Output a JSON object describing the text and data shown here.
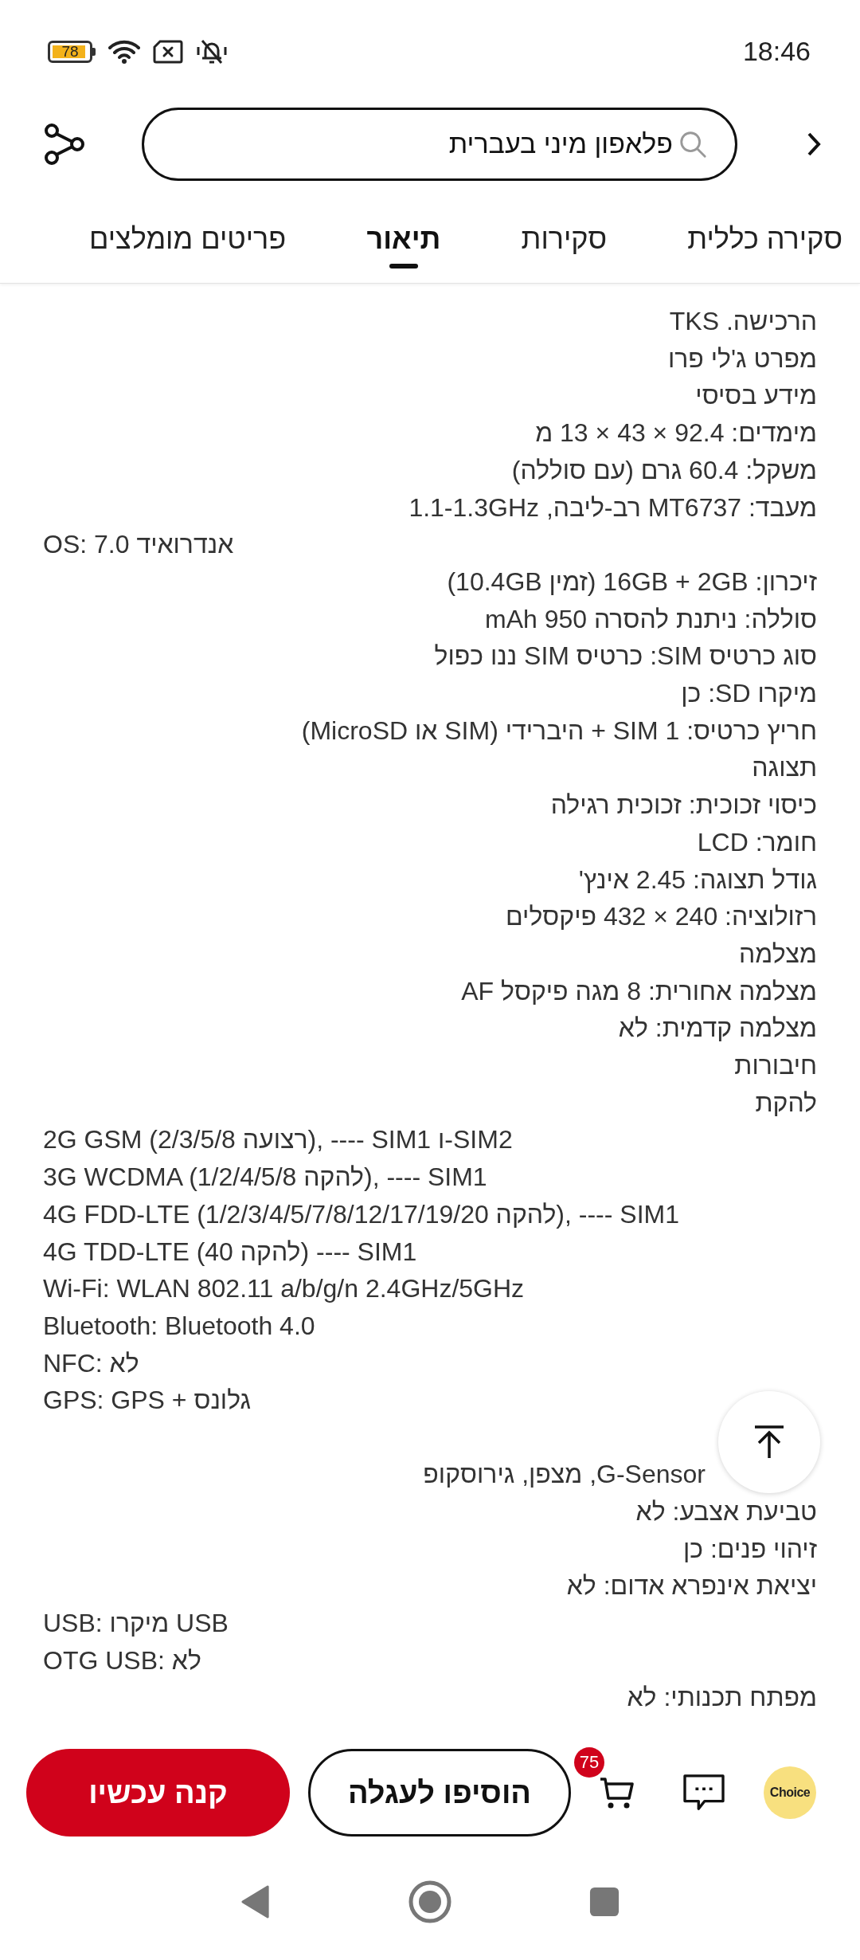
{
  "status_bar": {
    "battery": "78",
    "time": "18:46"
  },
  "search": {
    "value": "פלאפון מיני בעברית"
  },
  "tabs": [
    {
      "label": "סקירה כללית",
      "selected": false
    },
    {
      "label": "סקירות",
      "selected": false
    },
    {
      "label": "תיאור",
      "selected": true
    },
    {
      "label": "פריטים מומלצים",
      "selected": false
    }
  ],
  "description": [
    {
      "text": "הרכישה. TKS",
      "kind": "rtl"
    },
    {
      "text": "מפרט ג'לי פרו",
      "kind": "rtl"
    },
    {
      "text": "מידע בסיסי",
      "kind": "rtl"
    },
    {
      "text": "מימדים: 92.4 × 43 × 13 מ",
      "kind": "rtl"
    },
    {
      "text": "משקל: 60.4 גרם (עם סוללה)",
      "kind": "rtl"
    },
    {
      "text": "מעבד: MT6737 רב-ליבה, 1.1-1.3GHz",
      "kind": "rtl"
    },
    {
      "text": "OS: 7.0 אנדרואיד",
      "kind": "ltr"
    },
    {
      "text": "זיכרון: 16GB + 2GB (זמין 10.4GB)",
      "kind": "rtl"
    },
    {
      "text": "סוללה: ניתנת להסרה 950 mAh",
      "kind": "rtl"
    },
    {
      "text": "סוג כרטיס SIM: כרטיס SIM ננו כפול",
      "kind": "rtl"
    },
    {
      "text": "מיקרו SD: כן",
      "kind": "rtl"
    },
    {
      "text": "חריץ כרטיס: 1 SIM + היברידי (SIM או MicroSD)",
      "kind": "rtl"
    },
    {
      "text": "תצוגה",
      "kind": "rtl"
    },
    {
      "text": "כיסוי זכוכית: זכוכית רגילה",
      "kind": "rtl"
    },
    {
      "text": "חומר: LCD",
      "kind": "rtl"
    },
    {
      "text": "גודל תצוגה: 2.45 אינץ'",
      "kind": "rtl"
    },
    {
      "text": "רזולוציה: 240 × 432 פיקסלים",
      "kind": "rtl"
    },
    {
      "text": "מצלמה",
      "kind": "rtl"
    },
    {
      "text": "מצלמה אחורית: 8 מגה פיקסל AF",
      "kind": "rtl"
    },
    {
      "text": "מצלמה קדמית: לא",
      "kind": "rtl"
    },
    {
      "text": "חיבורות",
      "kind": "rtl"
    },
    {
      "text": "להקת",
      "kind": "rtl"
    },
    {
      "text": "2G GSM (2/3/5/8 רצועה), ---- SIM1 ו-SIM2",
      "kind": "ltr"
    },
    {
      "text": "3G WCDMA (1/2/4/5/8 להקה), ---- SIM1",
      "kind": "ltr"
    },
    {
      "text": "4G FDD-LTE (1/2/3/4/5/7/8/12/17/19/20 להקה), ---- SIM1",
      "kind": "ltr"
    },
    {
      "text": "4G TDD-LTE (40 להקה) ---- SIM1",
      "kind": "ltr"
    },
    {
      "text": "Wi-Fi: WLAN 802.11 a/b/g/n 2.4GHz/5GHz",
      "kind": "ltr"
    },
    {
      "text": "Bluetooth: Bluetooth 4.0",
      "kind": "ltr"
    },
    {
      "text": "NFC: לא",
      "kind": "ltr"
    },
    {
      "text": "GPS: GPS + גלונס",
      "kind": "ltr"
    },
    {
      "text": "G-Sensor, מצפן, גירוסקופ",
      "kind": "covered"
    },
    {
      "text": "טביעת אצבע: לא",
      "kind": "rtl"
    },
    {
      "text": "זיהוי פנים: כן",
      "kind": "rtl"
    },
    {
      "text": "יציאת אינפרא אדום: לא",
      "kind": "rtl"
    },
    {
      "text": "USB: מיקרו USB",
      "kind": "ltr"
    },
    {
      "text": "OTG USB: לא",
      "kind": "ltr"
    },
    {
      "text": "מפתח תכנותי: לא",
      "kind": "rtl"
    }
  ],
  "bottom_bar": {
    "choice_label": "Choice",
    "cart_count": "75",
    "add_to_cart": "הוסיפו לעגלה",
    "buy_now": "קנה עכשיו"
  }
}
